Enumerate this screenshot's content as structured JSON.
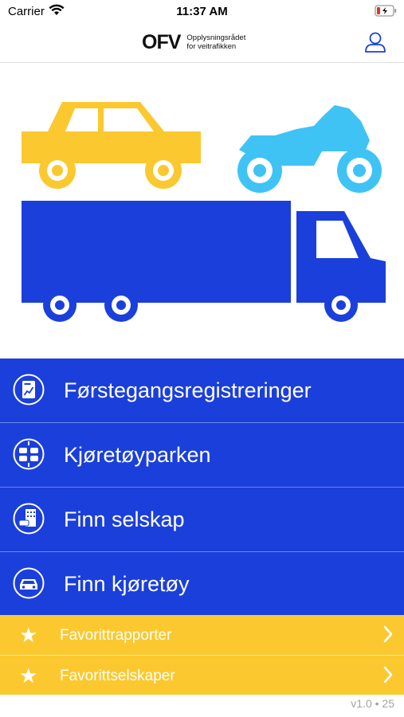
{
  "status_bar": {
    "carrier": "Carrier",
    "time": "11:37 AM"
  },
  "header": {
    "logo_mark": "OFV",
    "logo_line1": "Opplysningsrådet",
    "logo_line2": "for veitrafikken"
  },
  "hero": {
    "colors": {
      "car": "#fbc82f",
      "motorcycle": "#3fc3f5",
      "truck": "#1b3fdb"
    }
  },
  "menu": {
    "items": [
      {
        "label": "Førstegangsregistreringer",
        "icon": "report-chart-icon"
      },
      {
        "label": "Kjøretøyparken",
        "icon": "traffic-cars-icon"
      },
      {
        "label": "Finn selskap",
        "icon": "building-icon"
      },
      {
        "label": "Finn kjøretøy",
        "icon": "car-icon"
      }
    ]
  },
  "favorites": {
    "items": [
      {
        "label": "Favorittrapporter",
        "icon": "star-icon"
      },
      {
        "label": "Favorittselskaper",
        "icon": "star-icon"
      }
    ]
  },
  "footer": {
    "version": "v1.0 • 25"
  },
  "colors": {
    "menu_bg": "#1b3fdb",
    "favorites_bg": "#fbc82f"
  }
}
